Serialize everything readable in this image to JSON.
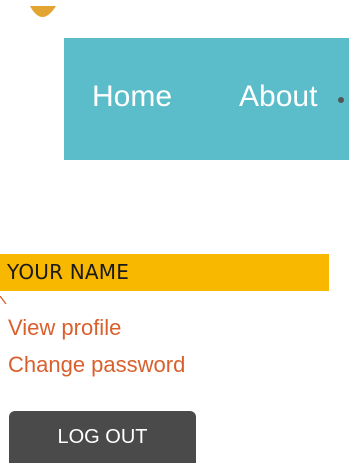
{
  "header": {
    "logo": "logo-icon"
  },
  "nav": {
    "items": [
      {
        "label": "Home"
      },
      {
        "label": "About"
      }
    ],
    "separator_icon": "dot-separator-icon",
    "background_color": "#5bbdc9",
    "text_color": "#ffffff"
  },
  "user_menu": {
    "name": "YOUR NAME",
    "background_color": "#f9b800",
    "links": [
      {
        "label": "View profile"
      },
      {
        "label": "Change password"
      }
    ],
    "link_color": "#d9602d",
    "logout_label": "LOG OUT",
    "logout_background": "#4a4a4a"
  }
}
